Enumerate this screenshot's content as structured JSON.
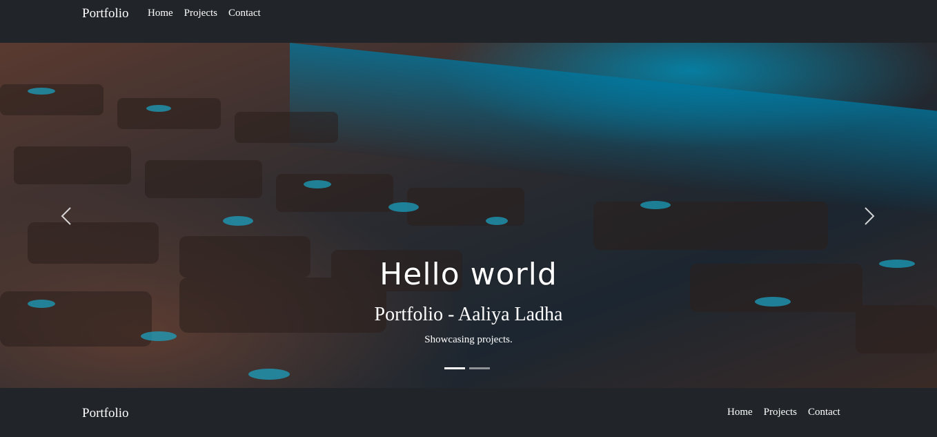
{
  "nav": {
    "brand": "Portfolio",
    "links": [
      "Home",
      "Projects",
      "Contact"
    ]
  },
  "carousel": {
    "heading": "Hello world",
    "title": "Portfolio - Aaliya Ladha",
    "subtitle": "Showcasing projects.",
    "prev_icon": "chevron-left-icon",
    "next_icon": "chevron-right-icon",
    "slide_count": 2,
    "active_slide": 1
  },
  "footer": {
    "brand": "Portfolio",
    "links": [
      "Home",
      "Projects",
      "Contact"
    ]
  },
  "colors": {
    "navbar_bg": "#212529",
    "text": "#ffffff",
    "accent_blue": "#1aa6c8"
  }
}
